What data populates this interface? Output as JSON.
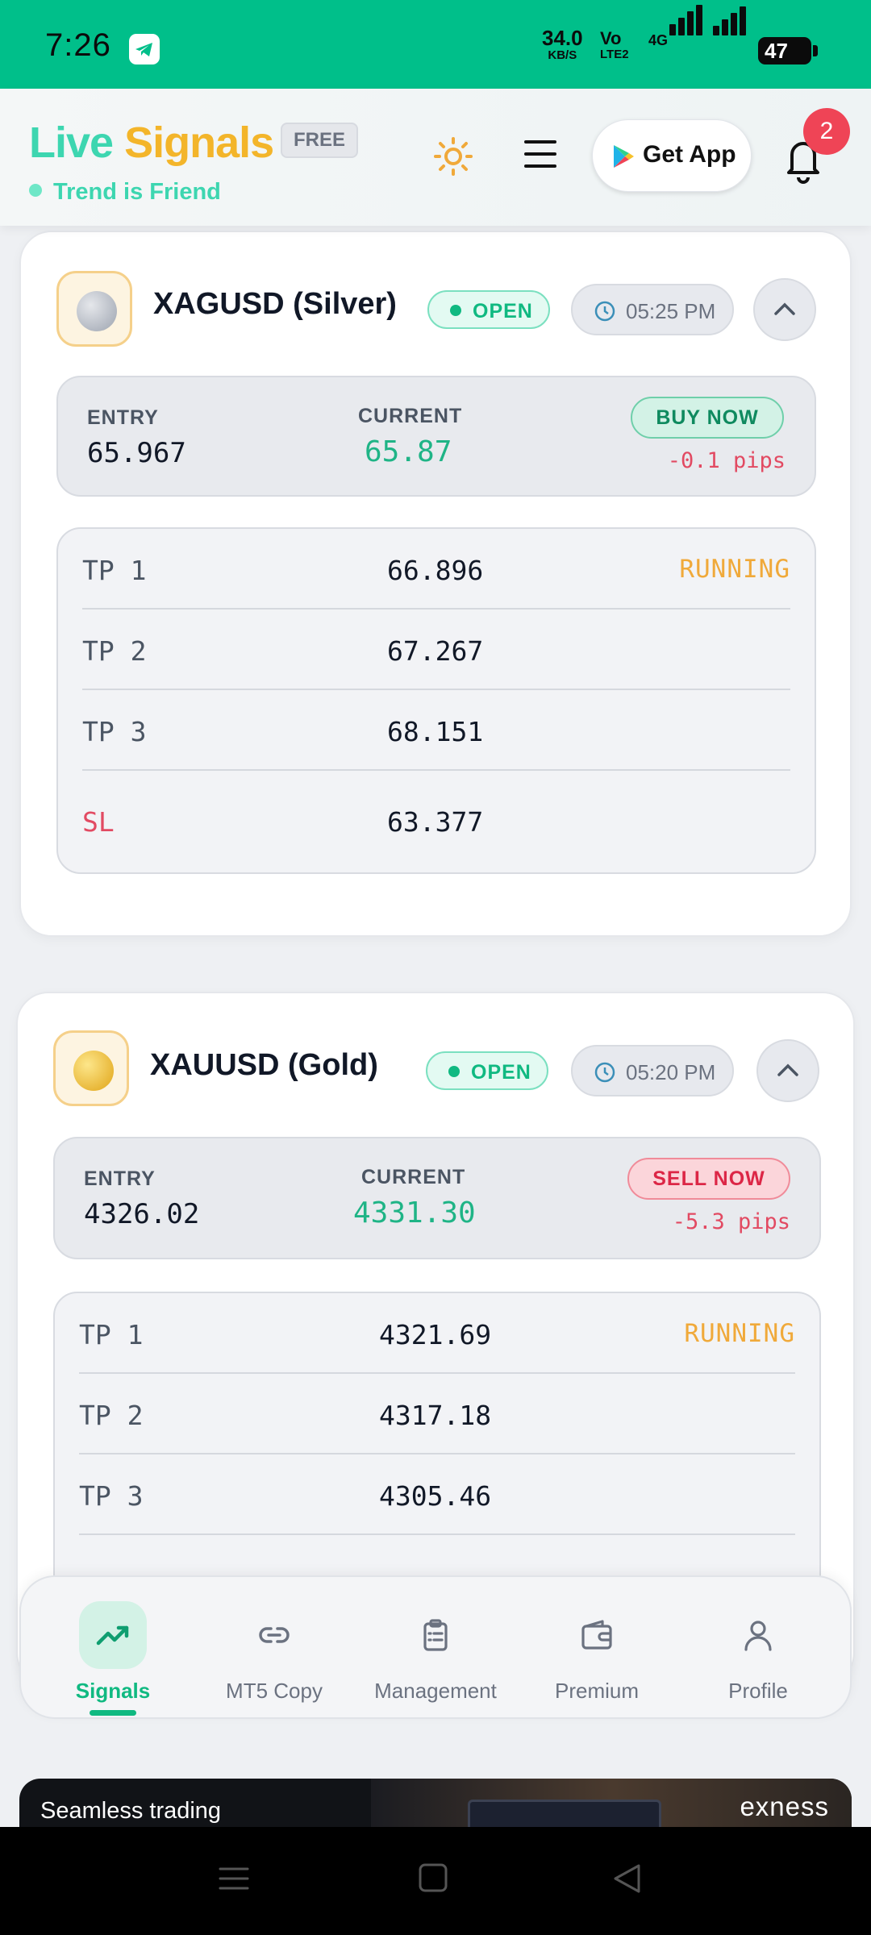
{
  "status_bar": {
    "time": "7:26",
    "net_speed": "34.0",
    "net_unit": "KB/S",
    "volte_top": "Vo",
    "volte_bottom": "LTE2",
    "network_type": "4G",
    "battery": "47"
  },
  "header": {
    "brand_part1": "Live",
    "brand_part2": "Signals",
    "tier_badge": "FREE",
    "tagline": "Trend is Friend",
    "get_app_label": "Get App",
    "notification_count": "2"
  },
  "signals": [
    {
      "symbol": "XAGUSD (Silver)",
      "status": "OPEN",
      "time": "05:25 PM",
      "entry_label": "ENTRY",
      "entry": "65.967",
      "current_label": "CURRENT",
      "current": "65.87",
      "action": "BUY NOW",
      "pips": "-0.1 pips",
      "levels": [
        {
          "label": "TP 1",
          "value": "66.896",
          "state": "RUNNING"
        },
        {
          "label": "TP 2",
          "value": "67.267",
          "state": ""
        },
        {
          "label": "TP 3",
          "value": "68.151",
          "state": ""
        },
        {
          "label": "SL",
          "value": "63.377",
          "state": ""
        }
      ]
    },
    {
      "symbol": "XAUUSD (Gold)",
      "status": "OPEN",
      "time": "05:20 PM",
      "entry_label": "ENTRY",
      "entry": "4326.02",
      "current_label": "CURRENT",
      "current": "4331.30",
      "action": "SELL NOW",
      "pips": "-5.3 pips",
      "levels": [
        {
          "label": "TP 1",
          "value": "4321.69",
          "state": "RUNNING"
        },
        {
          "label": "TP 2",
          "value": "4317.18",
          "state": ""
        },
        {
          "label": "TP 3",
          "value": "4305.46",
          "state": ""
        }
      ]
    }
  ],
  "bottom_nav": [
    {
      "label": "Signals",
      "icon": "trending-up-icon",
      "active": true
    },
    {
      "label": "MT5 Copy",
      "icon": "link-icon",
      "active": false
    },
    {
      "label": "Management",
      "icon": "clipboard-icon",
      "active": false
    },
    {
      "label": "Premium",
      "icon": "wallet-icon",
      "active": false
    },
    {
      "label": "Profile",
      "icon": "user-icon",
      "active": false
    }
  ],
  "ad": {
    "text": "Seamless trading",
    "brand": "exness"
  },
  "colors": {
    "status_bar": "#00bf8a",
    "accent_green": "#10b981",
    "accent_yellow": "#f3b52a",
    "sell_red": "#dc2646",
    "running": "#f0a93a"
  }
}
